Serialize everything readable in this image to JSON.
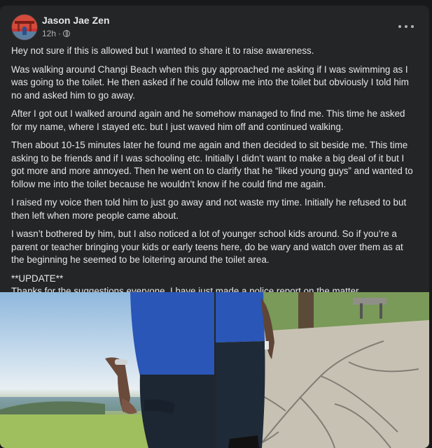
{
  "post": {
    "author": "Jason Jae Zen",
    "time": "12h",
    "time_separator": "·",
    "paragraphs": [
      "Hey not sure if this is allowed but I wanted to share it to raise awareness.",
      "Was walking around Changi Beach when this guy approached me asking if I was swimming as I was going to the toilet. He then asked if he could follow me into the toilet but obviously I told him no and asked him to go away.",
      "After I got out I walked around again and he somehow managed to find me. This time he asked for my name, where I stayed etc. but I just waved him off and continued walking.",
      "Then about 10-15 minutes later he found me again and then decided to sit beside me. This time asking to be friends and if I was schooling etc. Initially I didn’t want to make a big deal of it but I got more and more annoyed. Then he went on to clarify that he “liked young guys” and wanted to follow me into the toilet because he wouldn’t know if he could find me again.",
      "I raised my voice then told him to just go away and not waste my time. Initially he refused to but then left when more people came about.",
      "I wasn’t bothered by him, but I also noticed a lot of younger school kids around. So if you’re a parent or teacher bringing your kids or early teens here, do be wary and watch over them as at the beginning he seemed to be loitering around the toilet area."
    ],
    "update_heading": "**UPDATE**",
    "update_text": "Thanks for the suggestions everyone, I have just made a police report on the matter."
  },
  "icons": {
    "privacy": "globe-icon",
    "menu": "more-options-icon"
  },
  "colors": {
    "card_bg": "#242526",
    "page_bg": "#18191a",
    "text_primary": "#e4e6eb",
    "text_secondary": "#b0b3b8"
  }
}
